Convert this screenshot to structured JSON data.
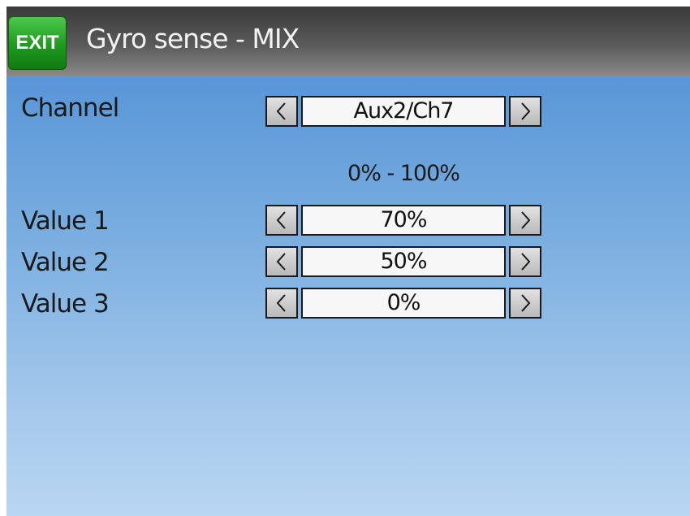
{
  "header": {
    "exit_label": "EXIT",
    "title": "Gyro sense - MIX"
  },
  "channel": {
    "label": "Channel",
    "value": "Aux2/Ch7"
  },
  "range_text": "0% - 100%",
  "values": [
    {
      "label": "Value 1",
      "value": "70%"
    },
    {
      "label": "Value 2",
      "value": "50%"
    },
    {
      "label": "Value 3",
      "value": "0%"
    }
  ],
  "icons": {
    "decrement": "chevron-left-icon",
    "increment": "chevron-right-icon"
  },
  "colors": {
    "exit_button": "#1f9a1f",
    "titlebar": "#4a4a4a",
    "background_top": "#4a8ad4",
    "background_bottom": "#b9d6f2"
  }
}
